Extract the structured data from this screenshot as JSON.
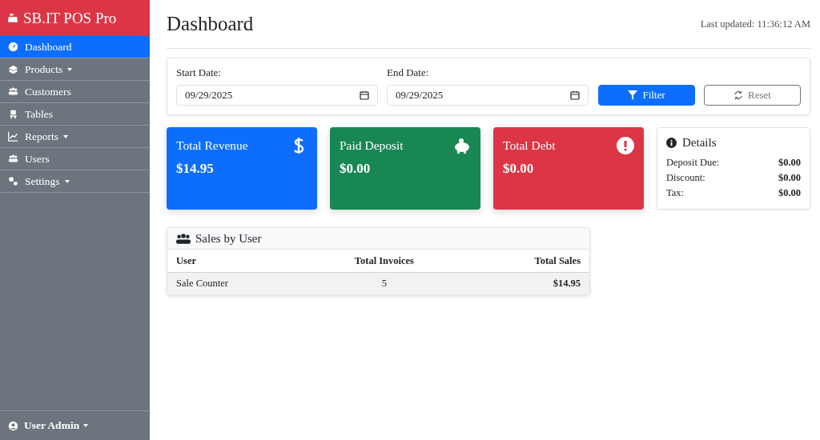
{
  "brand": {
    "title": "SB.IT POS Pro"
  },
  "sidebar": {
    "items": [
      {
        "label": "Dashboard",
        "selected": true,
        "has_menu": false
      },
      {
        "label": "Products",
        "selected": false,
        "has_menu": true
      },
      {
        "label": "Customers",
        "selected": false,
        "has_menu": false
      },
      {
        "label": "Tables",
        "selected": false,
        "has_menu": false
      },
      {
        "label": "Reports",
        "selected": false,
        "has_menu": true
      },
      {
        "label": "Users",
        "selected": false,
        "has_menu": false
      },
      {
        "label": "Settings",
        "selected": false,
        "has_menu": true
      }
    ],
    "user": {
      "label": "User Admin"
    }
  },
  "header": {
    "title": "Dashboard",
    "last_updated": "Last updated: 11:36:12 AM"
  },
  "filter": {
    "start_label": "Start Date:",
    "start_value": "09/29/2025",
    "end_label": "End Date:",
    "end_value": "09/29/2025",
    "filter_button": "Filter",
    "reset_button": "Reset"
  },
  "cards": [
    {
      "title": "Total Revenue",
      "value": "$14.95",
      "color": "#0d6efd"
    },
    {
      "title": "Paid Deposit",
      "value": "$0.00",
      "color": "#198754"
    },
    {
      "title": "Total Debt",
      "value": "$0.00",
      "color": "#dc3545"
    }
  ],
  "details": {
    "title": "Details",
    "rows": [
      {
        "label": "Deposit Due:",
        "value": "$0.00"
      },
      {
        "label": "Discount:",
        "value": "$0.00"
      },
      {
        "label": "Tax:",
        "value": "$0.00"
      }
    ]
  },
  "sales_by_user": {
    "title": "Sales by User",
    "columns": [
      "User",
      "Total Invoices",
      "Total Sales"
    ],
    "rows": [
      {
        "user": "Sale Counter",
        "invoices": "5",
        "sales": "$14.95"
      }
    ]
  }
}
